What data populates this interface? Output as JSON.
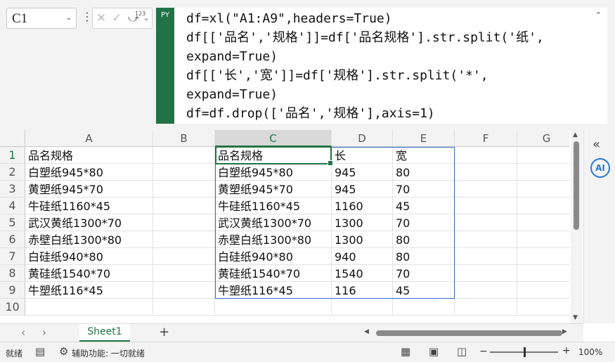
{
  "formula_bar": {
    "name_box": "C1",
    "badge": "PY",
    "code_lines": [
      "df=xl(\"A1:A9\",headers=True)",
      "df[['品名','规格']]=df['品名规格'].str.split('纸',",
      "expand=True)",
      "df[['长','宽']]=df['规格'].str.split('*',",
      "expand=True)",
      "df=df.drop(['品名','规格'],axis=1)"
    ]
  },
  "columns": [
    "A",
    "B",
    "C",
    "D",
    "E",
    "F",
    "G"
  ],
  "rows": [
    "1",
    "2",
    "3",
    "4",
    "5",
    "6",
    "7",
    "8",
    "9",
    "10"
  ],
  "cells": {
    "A": [
      "品名规格",
      "白塑纸945*80",
      "黄塑纸945*70",
      "牛硅纸1160*45",
      "武汉黄纸1300*70",
      "赤壁白纸1300*80",
      "白硅纸940*80",
      "黄硅纸1540*70",
      "牛塑纸116*45"
    ],
    "C": [
      "品名规格",
      "白塑纸945*80",
      "黄塑纸945*70",
      "牛硅纸1160*45",
      "武汉黄纸1300*70",
      "赤壁白纸1300*80",
      "白硅纸940*80",
      "黄硅纸1540*70",
      "牛塑纸116*45"
    ],
    "D": [
      "长",
      "945",
      "945",
      "1160",
      "1300",
      "1300",
      "940",
      "1540",
      "116"
    ],
    "E": [
      "宽",
      "80",
      "70",
      "45",
      "70",
      "80",
      "80",
      "70",
      "45"
    ]
  },
  "sheet_tab": "Sheet1",
  "status": {
    "ready": "就绪",
    "accessibility": "辅助功能: 一切就绪",
    "zoom": "100%"
  },
  "colors": {
    "accent": "#217346",
    "spill_border": "#2f6fd1"
  }
}
